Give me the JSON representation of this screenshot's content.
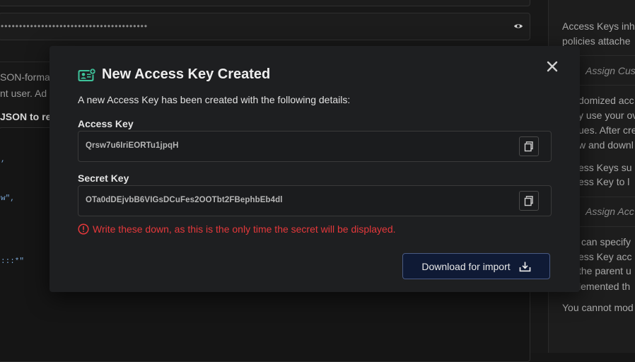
{
  "background": {
    "password_mask": "••••••••••••••••••••••••••••••••••••••••",
    "description_line1": "SON-forma",
    "description_line2": "nt user. Ad",
    "description_line3": "JSON to re",
    "code_lines": [
      ",",
      "w\",",
      ":::*\""
    ],
    "sidebar": {
      "lines": [
        "Access Keys inh",
        "policies attache",
        "domized acc",
        "y use your ov",
        "ues. After cre",
        "w and downl",
        "ess Keys su",
        "ess Key to l",
        "can specify",
        "ess Key acc",
        "the parent u",
        "lemented th",
        "You cannot mod"
      ],
      "italic_1": "Assign Cus",
      "italic_2": "Assign Acc"
    }
  },
  "modal": {
    "title": "New Access Key Created",
    "intro": "A new Access Key has been created with the following details:",
    "access_key": {
      "label": "Access Key",
      "value": "Qrsw7u6IriEORTu1jpqH"
    },
    "secret_key": {
      "label": "Secret Key",
      "value": "OTa0dDEjvbB6VIGsDCuFes2OOTbt2FBephbEb4dl"
    },
    "warning": "Write these down, as this is the only time the secret will be displayed.",
    "download_label": "Download for import",
    "colors": {
      "accent_icon": "#3ec29a",
      "warning": "#e5383b",
      "button_bg": "#0f1a35"
    }
  }
}
